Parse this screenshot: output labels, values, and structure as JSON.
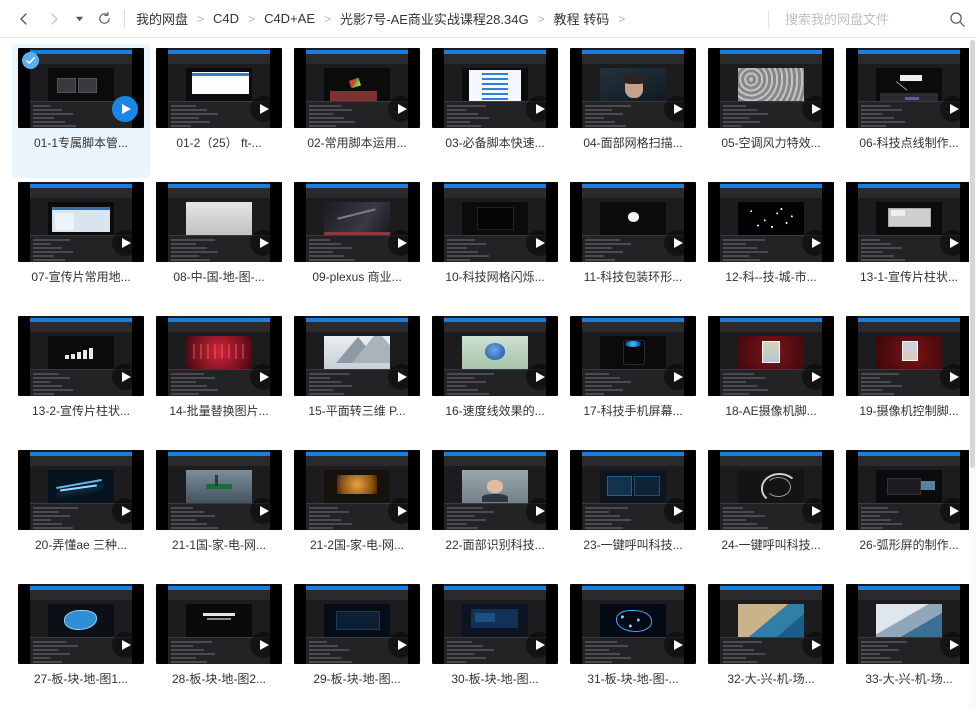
{
  "window": {
    "title": "我的网盘 - 教程 转码"
  },
  "toolbar": {
    "back_icon": "chevron-left-icon",
    "forward_icon": "chevron-right-icon",
    "history_caret_icon": "caret-down-icon",
    "refresh_icon": "refresh-icon"
  },
  "breadcrumb": {
    "separator": "&gt;",
    "items": [
      "我的网盘",
      "C4D",
      "C4D+AE",
      "光影7号-AE商业实战课程28.34G",
      "教程 转码"
    ]
  },
  "search": {
    "placeholder": "搜索我的网盘文件",
    "value": "",
    "icon": "search-icon"
  },
  "colors": {
    "accent": "#1a86e8",
    "selected_bg": "#eaf4fd",
    "check_badge": "#5ab0ef",
    "thumb_strip": "#1a7ee0",
    "text": "#333333",
    "placeholder": "#bfbfbf"
  },
  "grid": {
    "columns": 7,
    "play_icon": "play-icon",
    "check_icon": "check-icon",
    "items": [
      {
        "label": "01-1专属脚本管...",
        "selected": true,
        "play_style": "blue",
        "art": "ae-dark-panels"
      },
      {
        "label": "01-2（25）    ft-...",
        "selected": false,
        "play_style": "dark",
        "art": "white-doc"
      },
      {
        "label": "02-常用脚本运用...",
        "selected": false,
        "play_style": "dark",
        "art": "color-cube"
      },
      {
        "label": "03-必备脚本快速...",
        "selected": false,
        "play_style": "dark",
        "art": "blue-text-doc"
      },
      {
        "label": "04-面部网格扫描...",
        "selected": false,
        "play_style": "dark",
        "art": "portrait-face"
      },
      {
        "label": "05-空调风力特效...",
        "selected": false,
        "play_style": "dark",
        "art": "grey-noise"
      },
      {
        "label": "06-科技点线制作...",
        "selected": false,
        "play_style": "dark",
        "art": "label-5g"
      },
      {
        "label": "07-宣传片常用地...",
        "selected": false,
        "play_style": "dark",
        "art": "file-browser"
      },
      {
        "label": "08-中-国-地-图-...",
        "selected": false,
        "play_style": "dark",
        "art": "grey-flat"
      },
      {
        "label": "09-plexus 商业...",
        "selected": false,
        "play_style": "dark",
        "art": "dark-gradient"
      },
      {
        "label": "10-科技网格闪烁...",
        "selected": false,
        "play_style": "dark",
        "art": "black-box"
      },
      {
        "label": "11-科技包装环形...",
        "selected": false,
        "play_style": "dark",
        "art": "white-circle"
      },
      {
        "label": "12-科--技-城-市...",
        "selected": false,
        "play_style": "dark",
        "art": "starfield"
      },
      {
        "label": "13-1-宣传片柱状...",
        "selected": false,
        "play_style": "dark",
        "art": "grey-ui-box"
      },
      {
        "label": "13-2-宣传片柱状...",
        "selected": false,
        "play_style": "dark",
        "art": "bar-chart"
      },
      {
        "label": "14-批量替换图片...",
        "selected": false,
        "play_style": "dark",
        "art": "red-texture"
      },
      {
        "label": "15-平面转三维 P...",
        "selected": false,
        "play_style": "dark",
        "art": "mountain"
      },
      {
        "label": "16-速度线效果的...",
        "selected": false,
        "play_style": "dark",
        "art": "blue-rose"
      },
      {
        "label": "17-科技手机屏幕...",
        "selected": false,
        "play_style": "dark",
        "art": "phone-blue-glow"
      },
      {
        "label": "18-AE摄像机脚...",
        "selected": false,
        "play_style": "dark",
        "art": "red-poster"
      },
      {
        "label": "19-摄像机控制脚...",
        "selected": false,
        "play_style": "dark",
        "art": "red-poster2"
      },
      {
        "label": "20-弄懂ae 三种...",
        "selected": false,
        "play_style": "dark",
        "art": "blue-streaks"
      },
      {
        "label": "21-1国-家-电-网...",
        "selected": false,
        "play_style": "dark",
        "art": "tower-green"
      },
      {
        "label": "21-2国-家-电-网...",
        "selected": false,
        "play_style": "dark",
        "art": "orange-room"
      },
      {
        "label": "22-面部识别科技...",
        "selected": false,
        "play_style": "dark",
        "art": "person-interview"
      },
      {
        "label": "23-一键呼叫科技...",
        "selected": false,
        "play_style": "dark",
        "art": "blue-ui"
      },
      {
        "label": "24-一键呼叫科技...",
        "selected": false,
        "play_style": "dark",
        "art": "radial-arcs"
      },
      {
        "label": "26-弧形屏的制作...",
        "selected": false,
        "play_style": "dark",
        "art": "wide-screen"
      },
      {
        "label": "27-板-块-地-图1...",
        "selected": false,
        "play_style": "dark",
        "art": "blue-map-shape"
      },
      {
        "label": "28-板-块-地-图2...",
        "selected": false,
        "play_style": "dark",
        "art": "text-dark"
      },
      {
        "label": "29-板-块-地-图...",
        "selected": false,
        "play_style": "dark",
        "art": "dark-blue-ui"
      },
      {
        "label": "30-板-块-地-图...",
        "selected": false,
        "play_style": "dark",
        "art": "blue-panel"
      },
      {
        "label": "31-板-块-地-图-...",
        "selected": false,
        "play_style": "dark",
        "art": "network-map"
      },
      {
        "label": "32-大-兴-机-场...",
        "selected": false,
        "play_style": "dark",
        "art": "satellite-coast"
      },
      {
        "label": "33-大-兴-机-场...",
        "selected": false,
        "play_style": "dark",
        "art": "satellite-snow"
      }
    ]
  },
  "scrollbar": {
    "orientation": "vertical",
    "thumb_position_pct": 0,
    "thumb_size_pct": 64
  }
}
